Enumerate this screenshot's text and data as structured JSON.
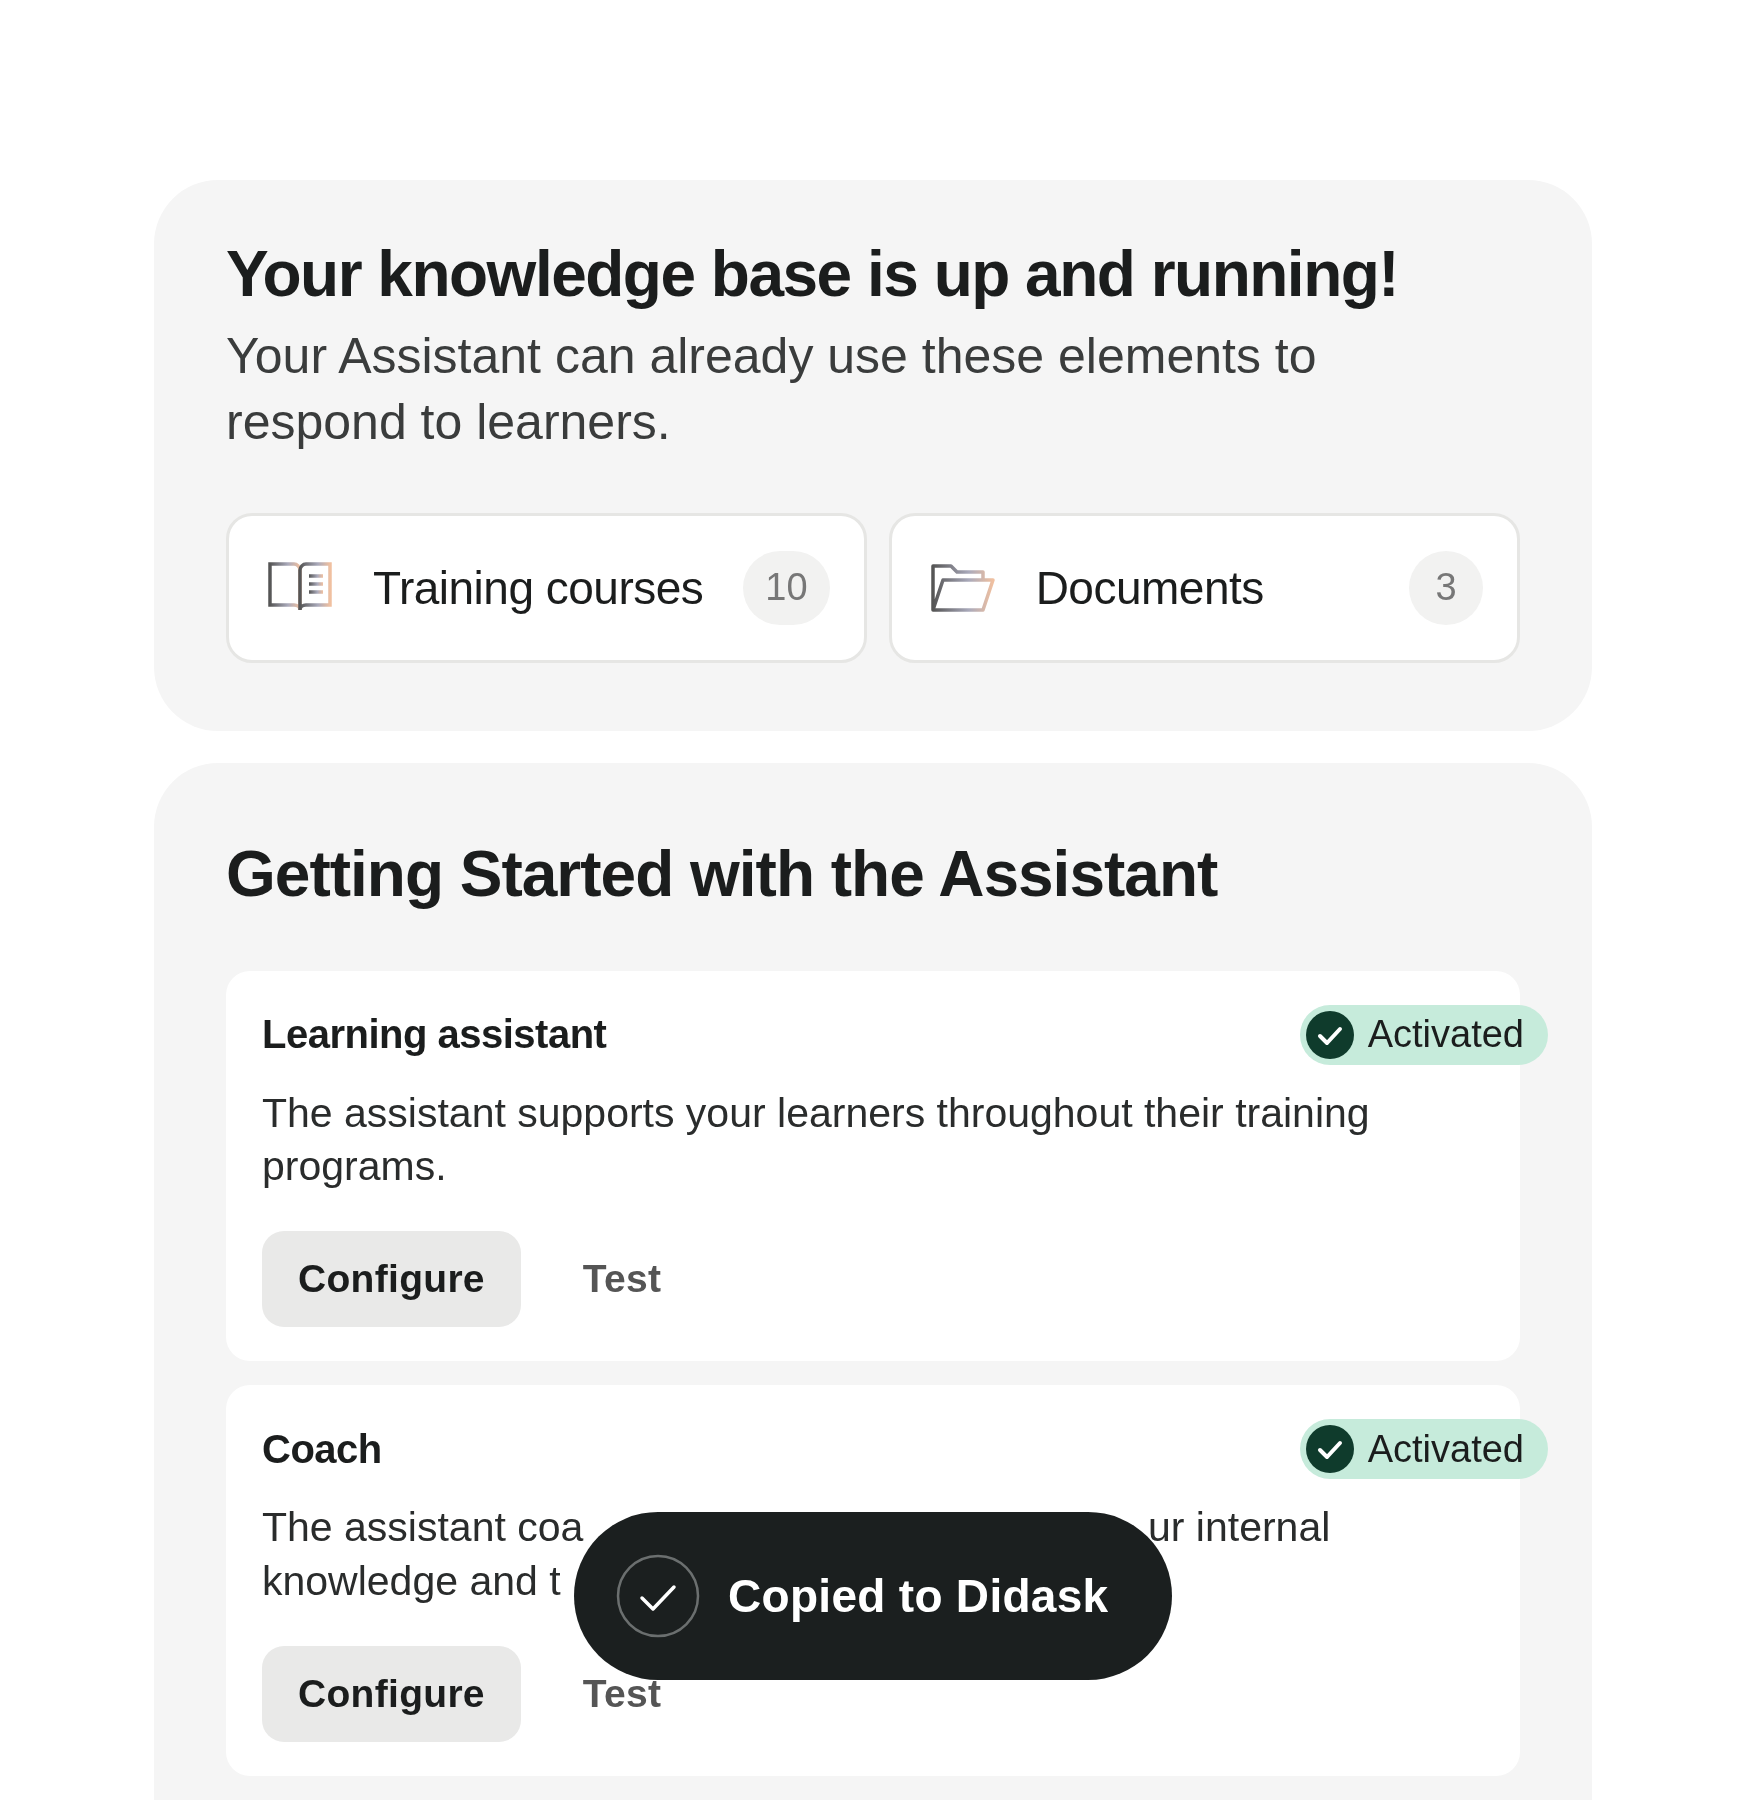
{
  "knowledge_base": {
    "title": "Your knowledge base is up and running!",
    "subtitle": "Your Assistant can already use these elements to respond to learners.",
    "sources": [
      {
        "kind": "book",
        "label": "Training courses",
        "count": "10"
      },
      {
        "kind": "folder",
        "label": "Documents",
        "count": "3"
      }
    ]
  },
  "getting_started": {
    "title": "Getting Started with the Assistant",
    "assistants": [
      {
        "name": "Learning assistant",
        "activated": true,
        "status": "Activated",
        "description_lines": [
          [
            "The assistant supports your learners throughout their training"
          ],
          [
            "programs."
          ]
        ],
        "buttons": [
          "Configure",
          "Test"
        ]
      },
      {
        "name": "Coach",
        "activated": true,
        "status": "Activated",
        "description_lines": [
          [
            "The assistant coa",
            "ur internal"
          ],
          [
            "knowledge and t"
          ]
        ],
        "buttons": [
          "Configure",
          "Test"
        ]
      }
    ]
  },
  "toast": {
    "message": "Copied to Didask"
  }
}
